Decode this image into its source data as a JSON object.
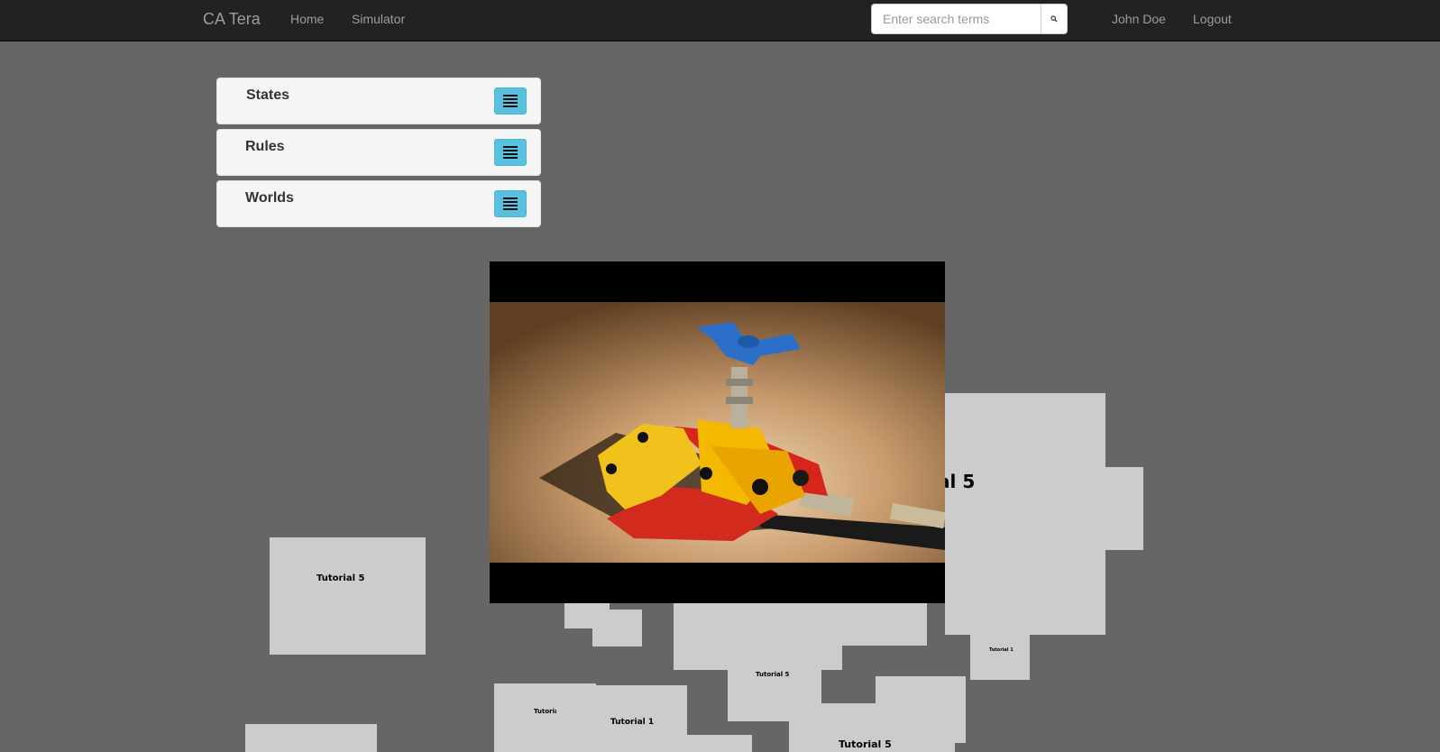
{
  "navbar": {
    "brand": "CA Tera",
    "links": [
      "Home",
      "Simulator"
    ],
    "search_placeholder": "Enter search terms",
    "user_name": "John Doe",
    "logout": "Logout"
  },
  "panels": [
    {
      "title": "States",
      "button_icon": "list-icon"
    },
    {
      "title": "Rules",
      "button_icon": "list-icon"
    },
    {
      "title": "Worlds",
      "button_icon": "list-icon"
    }
  ],
  "tiles": {
    "tutorial_5": "Tutorial 5",
    "tutorial_1": "Tutorial 1",
    "tutorial_5_partial": "al 5",
    "tutorial_small": "Tutorial 1"
  },
  "video": {
    "content": "lego-technic-model-image"
  },
  "colors": {
    "navbar": "#222222",
    "background": "#666666",
    "tile": "#cccccc",
    "panel_button": "#5bc0de"
  }
}
